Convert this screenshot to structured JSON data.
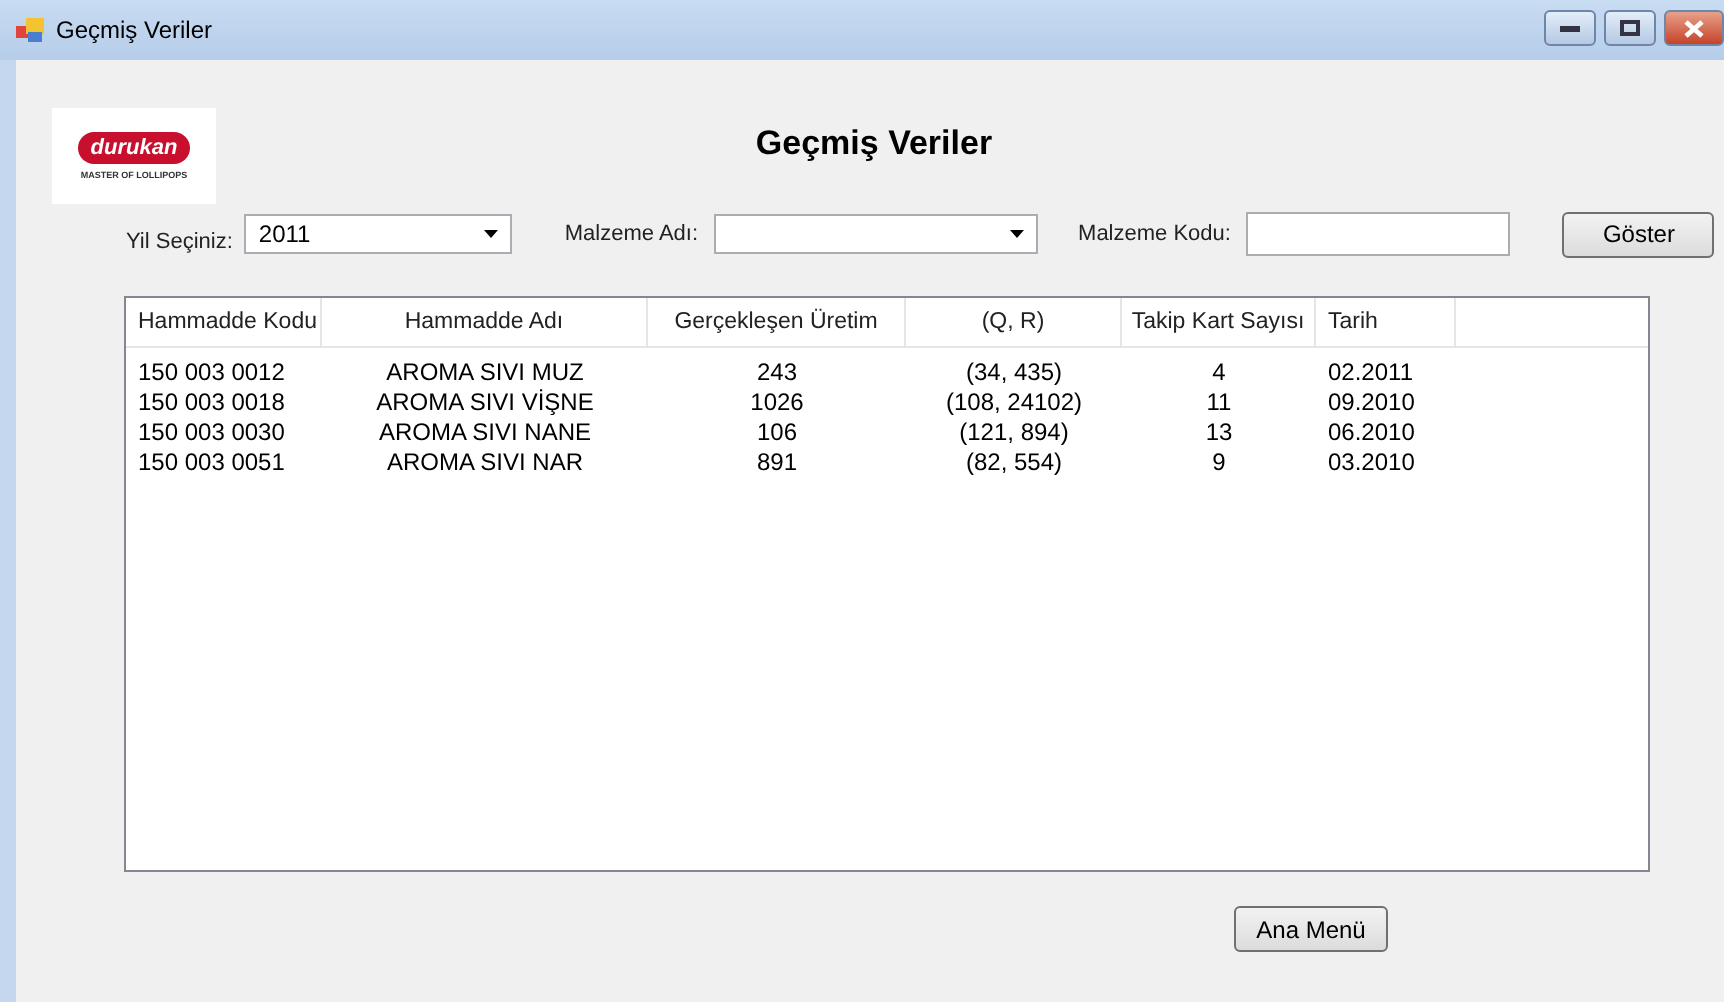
{
  "window": {
    "title": "Geçmiş Veriler"
  },
  "logo": {
    "brand": "durukan",
    "tagline": "MASTER OF LOLLIPOPS"
  },
  "heading": "Geçmiş Veriler",
  "filters": {
    "year_label": "Yil Seçiniz:",
    "year_value": "2011",
    "material_name_label": "Malzeme Adı:",
    "material_code_label": "Malzeme Kodu:",
    "show_button": "Göster"
  },
  "table": {
    "columns": [
      "Hammadde Kodu",
      "Hammadde Adı",
      "Gerçekleşen Üretim",
      "(Q, R)",
      "Takip Kart Sayısı",
      "Tarih"
    ],
    "rows": [
      [
        "150 003 0012",
        "AROMA SIVI MUZ",
        "243",
        "(34, 435)",
        "4",
        "02.2011"
      ],
      [
        "150 003 0018",
        "AROMA SIVI VİŞNE",
        "1026",
        "(108, 24102)",
        "11",
        "09.2010"
      ],
      [
        "150 003 0030",
        "AROMA SIVI NANE",
        "106",
        "(121, 894)",
        "13",
        "06.2010"
      ],
      [
        "150 003 0051",
        "AROMA SIVI NAR",
        "891",
        "(82, 554)",
        "9",
        "03.2010"
      ]
    ]
  },
  "footer_button": "Ana Menü"
}
